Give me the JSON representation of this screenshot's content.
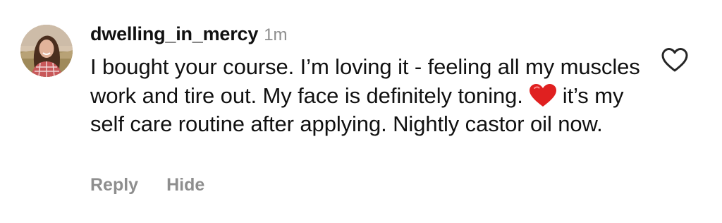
{
  "comment": {
    "username": "dwelling_in_mercy",
    "timestamp": "1m",
    "text_part1": "I bought your course.  I’m loving it - feeling all my muscles work and tire out.  My face is definitely toning.",
    "emoji": "red-heart",
    "text_part2": "it’s my self care routine after applying. Nightly castor oil now.",
    "avatar_icon": "profile-photo-avatar",
    "like_icon": "heart-outline-icon",
    "heart_color": "#e02020"
  },
  "actions": {
    "reply_label": "Reply",
    "hide_label": "Hide"
  },
  "colors": {
    "primary_text": "#111111",
    "secondary_text": "#8e8e8e",
    "background": "#ffffff"
  }
}
